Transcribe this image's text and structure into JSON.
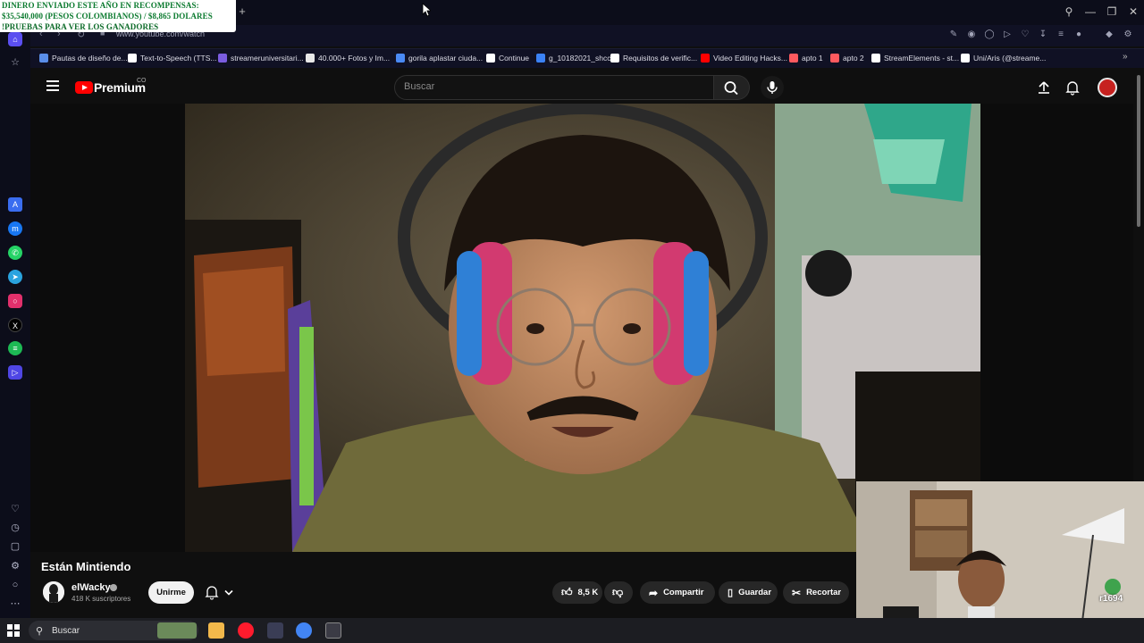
{
  "promo": {
    "line1": "DINERO ENVIADO ESTE AÑO EN RECOMPENSAS:",
    "line2": "$35,540,000 (PESOS COLOMBIANOS) / $8,865 DOLARES",
    "line3": "!PRUEBAS PARA VER LOS GANADORES"
  },
  "browser": {
    "url": "www.youtube.com/watch",
    "bookmarks": [
      {
        "label": "Pautas de diseño de...",
        "color": "#5a8ee8"
      },
      {
        "label": "Text-to-Speech (TTS...",
        "color": "#ffffff"
      },
      {
        "label": "streameruniversitari...",
        "color": "#7b5de0"
      },
      {
        "label": "40.000+ Fotos y Im...",
        "color": "#e8e8e8"
      },
      {
        "label": "gorila aplastar ciuda...",
        "color": "#4a8af4"
      },
      {
        "label": "Continue",
        "color": "#ffffff"
      },
      {
        "label": "g_10182021_shcc",
        "color": "#3b82f6"
      },
      {
        "label": "Requisitos de verific...",
        "color": "#ffffff"
      },
      {
        "label": "Video Editing Hacks...",
        "color": "#ff0000"
      },
      {
        "label": "apto 1",
        "color": "#ff5a5f"
      },
      {
        "label": "apto 2",
        "color": "#ff5a5f"
      },
      {
        "label": "StreamElements - st...",
        "color": "#ffffff"
      },
      {
        "label": "Uni/Aris (@streame...",
        "color": "#ffffff"
      }
    ]
  },
  "youtube": {
    "brand": "Premium",
    "country": "CO",
    "search_placeholder": "Buscar"
  },
  "video": {
    "title": "Están Mintiendo",
    "channel": "elWacky",
    "subscribers": "418 K suscriptores",
    "join_label": "Unirme",
    "likes": "8,5 K",
    "share_label": "Compartir",
    "save_label": "Guardar",
    "clip_label": "Recortar"
  },
  "webcam": {
    "badge_text": "r1694"
  },
  "taskbar": {
    "search_label": "Buscar"
  },
  "colors": {
    "yt_red": "#ff0000",
    "promo_green": "#0a7a2e",
    "opera_red": "#ff1b2d"
  }
}
